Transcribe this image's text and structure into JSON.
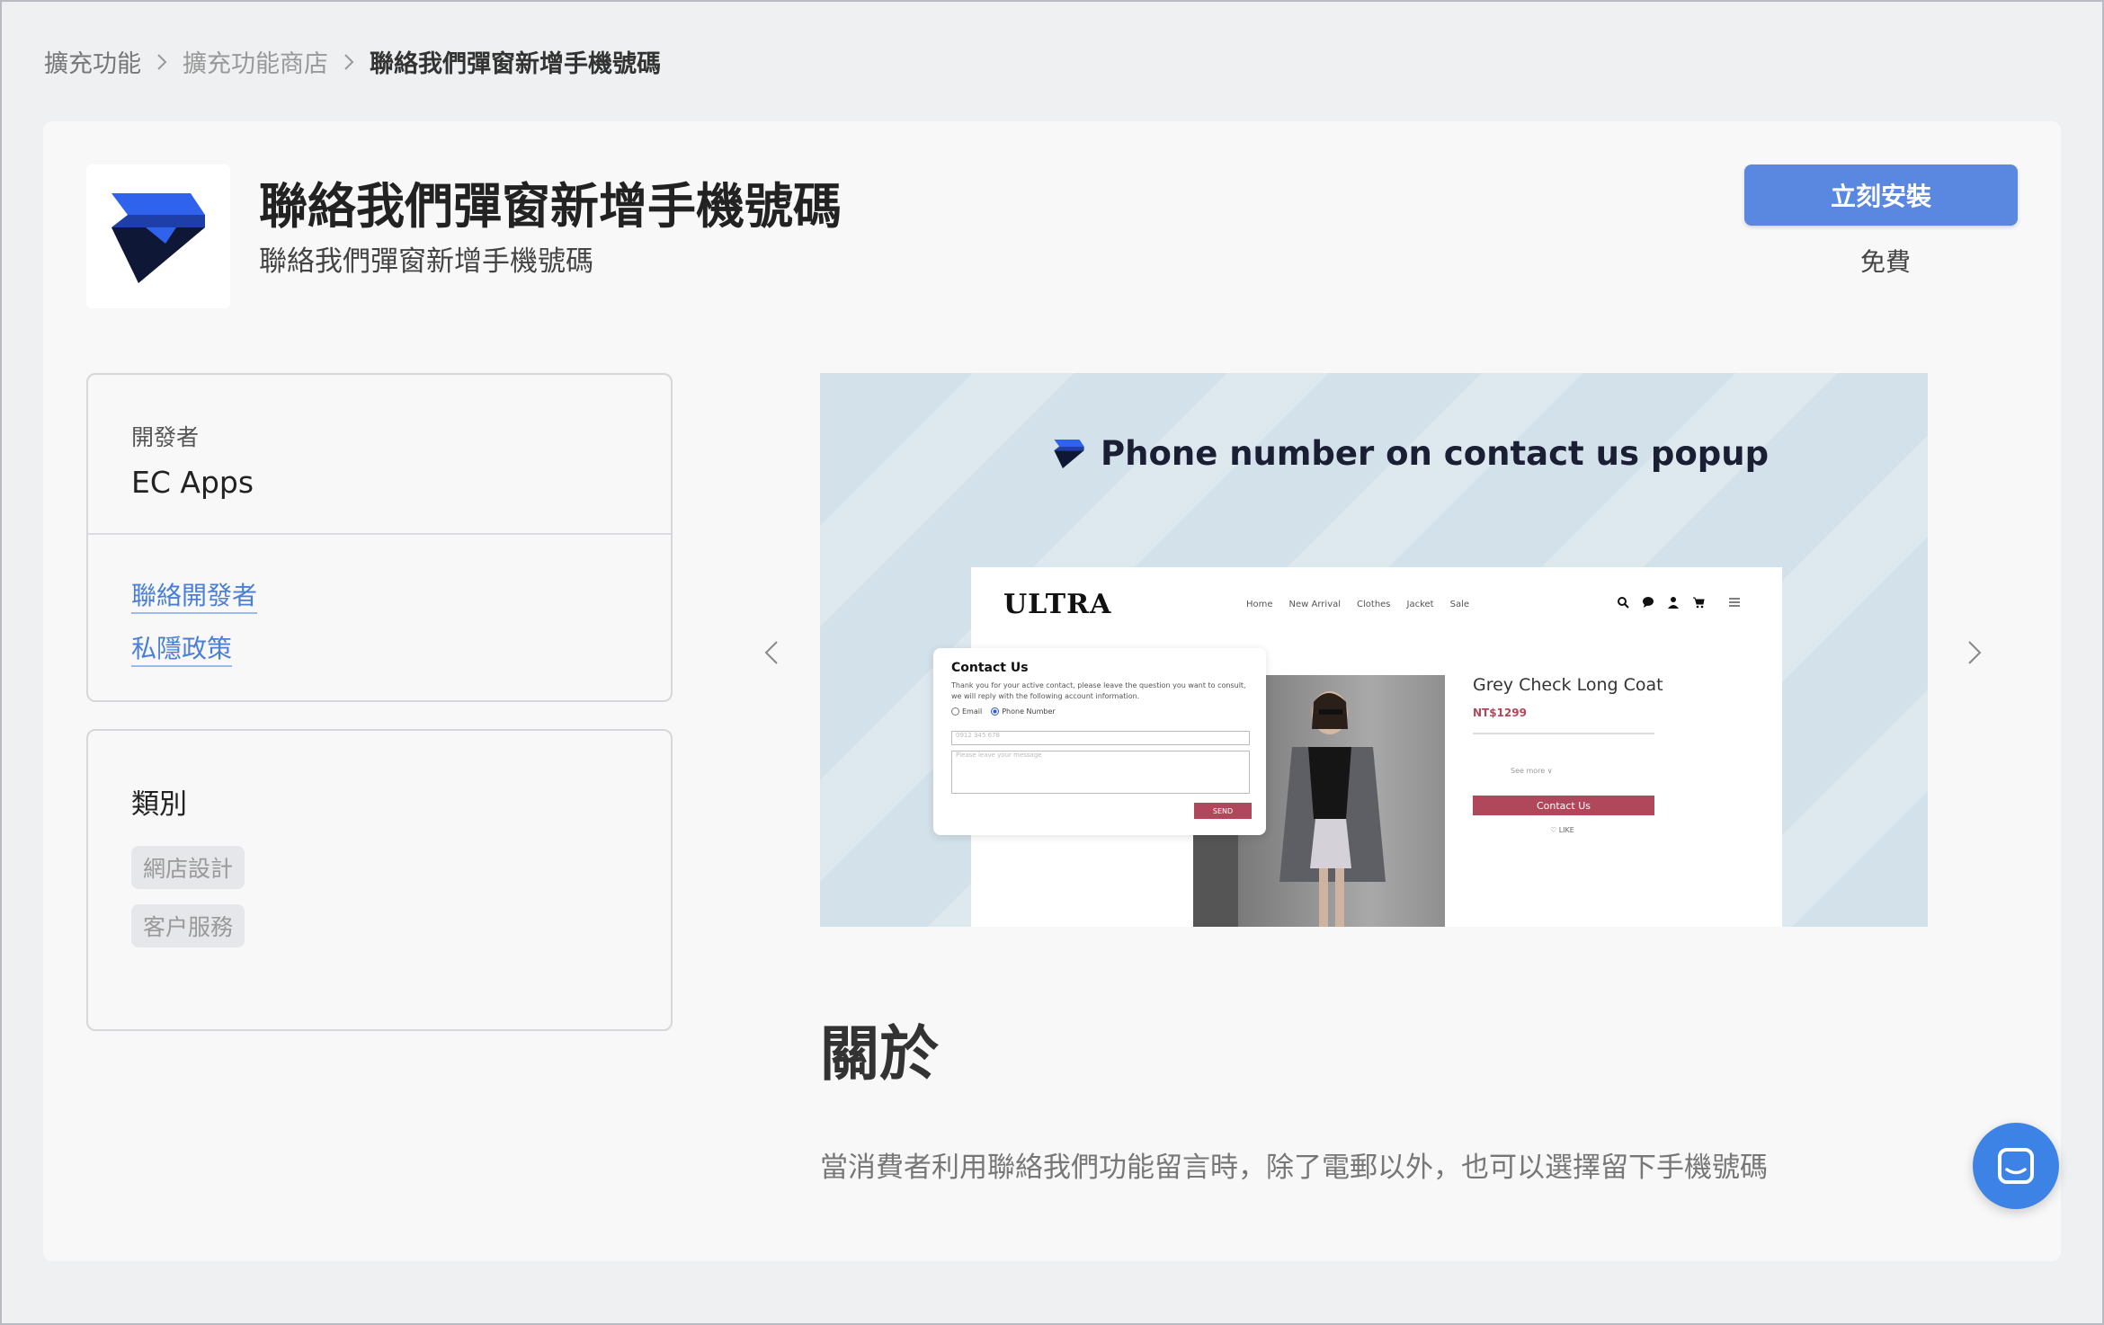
{
  "breadcrumb": {
    "items": [
      "擴充功能",
      "擴充功能商店",
      "聯絡我們彈窗新增手機號碼"
    ]
  },
  "app": {
    "title": "聯絡我們彈窗新增手機號碼",
    "subtitle": "聯絡我們彈窗新增手機號碼",
    "logo_icon": "ec-apps-logo-icon",
    "install_label": "立刻安裝",
    "price": "免費",
    "accent_color": "#5a87df"
  },
  "developer": {
    "label": "開發者",
    "name": "EC Apps",
    "links": [
      "聯絡開發者",
      "私隱政策"
    ]
  },
  "category": {
    "title": "類別",
    "tags": [
      "網店設計",
      "客户服務"
    ]
  },
  "carousel": {
    "prev_icon": "chevron-left-icon",
    "next_icon": "chevron-right-icon",
    "slide": {
      "heading": "Phone number on contact us popup",
      "mock_site": {
        "logo": "ULTRA",
        "nav": [
          "Home",
          "New Arrival",
          "Clothes",
          "Jacket",
          "Sale"
        ],
        "icons": [
          "search-icon",
          "chat-icon",
          "user-icon",
          "cart-icon",
          "menu-icon"
        ],
        "product_name": "Grey Check Long Coat",
        "product_price": "NT$1299",
        "see_more": "See more ∨",
        "contact_button": "Contact Us",
        "like": "♡ LIKE",
        "accent_color": "#b0475a"
      },
      "popup": {
        "title": "Contact Us",
        "text": "Thank you for your active contact, please leave the question you want to consult, we will reply with the following account information.",
        "radio_email": "Email",
        "radio_phone": "Phone Number",
        "phone_placeholder": "0912 345 678",
        "message_placeholder": "Please leave your message",
        "send": "SEND"
      }
    }
  },
  "about": {
    "title": "關於",
    "text": "當消費者利用聯絡我們功能留言時，除了電郵以外，也可以選擇留下手機號碼"
  },
  "chat": {
    "icon": "chat-bubble-icon",
    "color": "#3d83e6"
  }
}
